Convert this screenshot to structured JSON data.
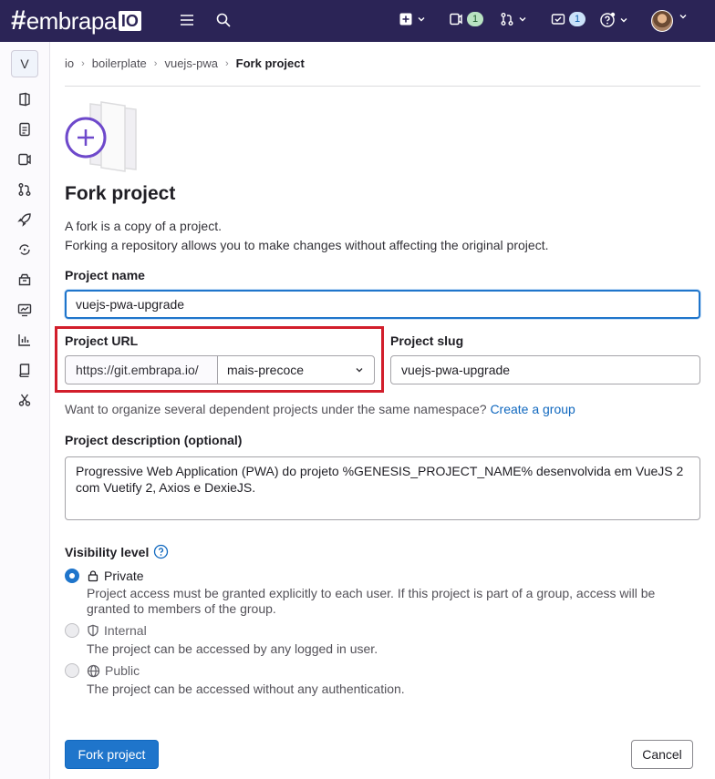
{
  "brand": {
    "hash": "#",
    "name": "embrapa",
    "suffix": "IO"
  },
  "navbar": {
    "issues_count": "1",
    "todos_count": "1"
  },
  "sidebar": {
    "project_initial": "V"
  },
  "breadcrumb": [
    "io",
    "boilerplate",
    "vuejs-pwa",
    "Fork project"
  ],
  "page": {
    "title": "Fork project",
    "description_line1": "A fork is a copy of a project.",
    "description_line2": "Forking a repository allows you to make changes without affecting the original project."
  },
  "form": {
    "project_name_label": "Project name",
    "project_name_value": "vuejs-pwa-upgrade",
    "project_url_label": "Project URL",
    "project_url_prefix": "https://git.embrapa.io/",
    "namespace_value": "mais-precoce",
    "project_slug_label": "Project slug",
    "project_slug_value": "vuejs-pwa-upgrade",
    "hint_text": "Want to organize several dependent projects under the same namespace?",
    "hint_link": "Create a group",
    "description_label": "Project description (optional)",
    "description_value": "Progressive Web Application (PWA) do projeto %GENESIS_PROJECT_NAME% desenvolvida em VueJS 2 com Vuetify 2, Axios e DexieJS.",
    "visibility_label": "Visibility level",
    "visibility_options": [
      {
        "label": "Private",
        "selected": true,
        "desc": "Project access must be granted explicitly to each user. If this project is part of a group, access will be granted to members of the group."
      },
      {
        "label": "Internal",
        "selected": false,
        "desc": "The project can be accessed by any logged in user."
      },
      {
        "label": "Public",
        "selected": false,
        "desc": "The project can be accessed without any authentication."
      }
    ],
    "submit_label": "Fork project",
    "cancel_label": "Cancel"
  },
  "colors": {
    "navbar": "#2b2456",
    "primary": "#1f75cb",
    "highlight": "#d21e2b"
  }
}
